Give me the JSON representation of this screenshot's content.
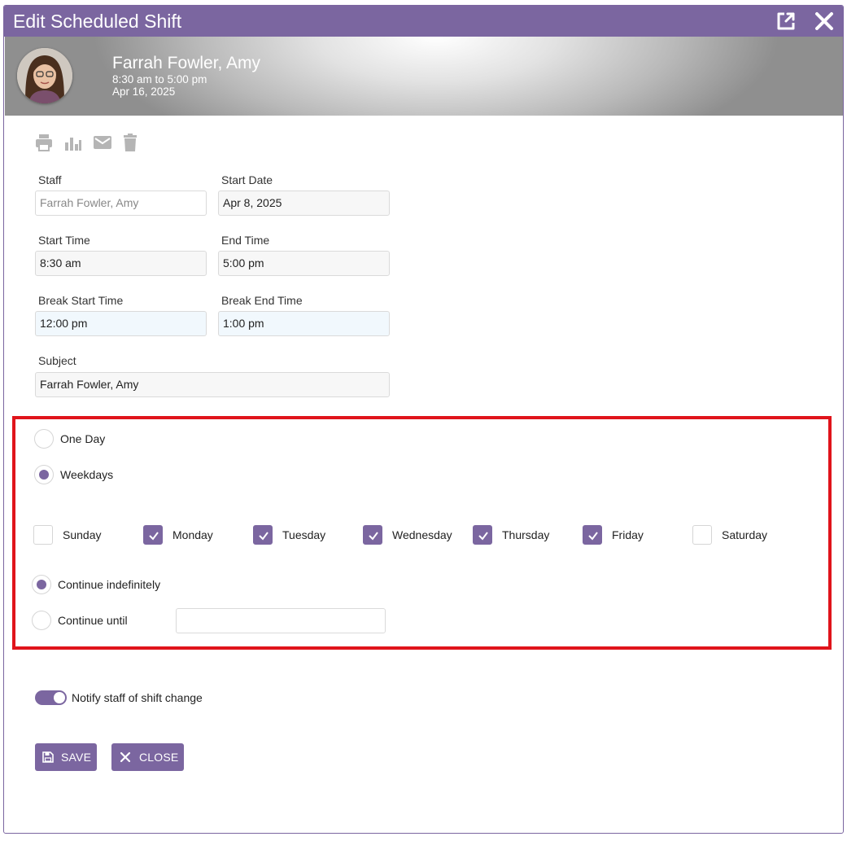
{
  "dialog": {
    "title": "Edit Scheduled Shift",
    "accent_color": "#7b66a0",
    "highlight_color": "#e0141b",
    "icons": [
      "popout-icon",
      "close-icon"
    ]
  },
  "banner": {
    "name": "Farrah Fowler, Amy",
    "time_range": "8:30 am to 5:00 pm",
    "date": "Apr 16, 2025"
  },
  "toolbar": {
    "icons": [
      "print-icon",
      "chart-icon",
      "email-icon",
      "delete-icon"
    ]
  },
  "form": {
    "staff_label": "Staff",
    "staff_value": "Farrah Fowler, Amy",
    "start_date_label": "Start Date",
    "start_date_value": "Apr 8, 2025",
    "start_time_label": "Start Time",
    "start_time_value": "8:30 am",
    "end_time_label": "End Time",
    "end_time_value": "5:00 pm",
    "break_start_label": "Break Start Time",
    "break_start_value": "12:00 pm",
    "break_end_label": "Break End Time",
    "break_end_value": "1:00 pm",
    "subject_label": "Subject",
    "subject_value": "Farrah Fowler, Amy"
  },
  "recurrence": {
    "options": [
      {
        "label": "One Day",
        "selected": false
      },
      {
        "label": "Weekdays",
        "selected": true
      }
    ],
    "days": [
      {
        "label": "Sunday",
        "checked": false
      },
      {
        "label": "Monday",
        "checked": true
      },
      {
        "label": "Tuesday",
        "checked": true
      },
      {
        "label": "Wednesday",
        "checked": true
      },
      {
        "label": "Thursday",
        "checked": true
      },
      {
        "label": "Friday",
        "checked": true
      },
      {
        "label": "Saturday",
        "checked": false
      }
    ],
    "continue_indefinitely": {
      "label": "Continue indefinitely",
      "selected": true
    },
    "continue_until": {
      "label": "Continue until",
      "selected": false,
      "value": ""
    }
  },
  "notify": {
    "label": "Notify staff of shift change",
    "enabled": true
  },
  "buttons": {
    "save": "SAVE",
    "close": "CLOSE"
  }
}
